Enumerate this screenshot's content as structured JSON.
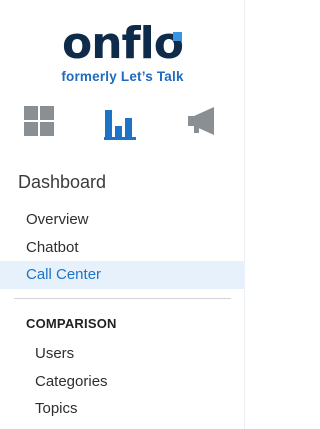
{
  "logo": {
    "wordmark": "onflo",
    "tagline": "formerly Let’s Talk"
  },
  "icon_bar": {
    "items": [
      {
        "icon": "grid-icon",
        "color": "#8a8f94"
      },
      {
        "icon": "bar-chart-icon",
        "color": "#1d73c6"
      },
      {
        "icon": "megaphone-icon",
        "color": "#8a8f94"
      }
    ]
  },
  "section": {
    "title": "Dashboard"
  },
  "nav": {
    "items": [
      {
        "label": "Overview"
      },
      {
        "label": "Chatbot"
      },
      {
        "label": "Call Center"
      }
    ],
    "active_index": 2
  },
  "comparison": {
    "title": "COMPARISON",
    "items": [
      {
        "label": "Users"
      },
      {
        "label": "Categories"
      },
      {
        "label": "Topics"
      }
    ]
  },
  "colors": {
    "accent": "#1d73c6",
    "active_bg": "#e6f1fb",
    "brand_dark": "#0f2b4a"
  }
}
